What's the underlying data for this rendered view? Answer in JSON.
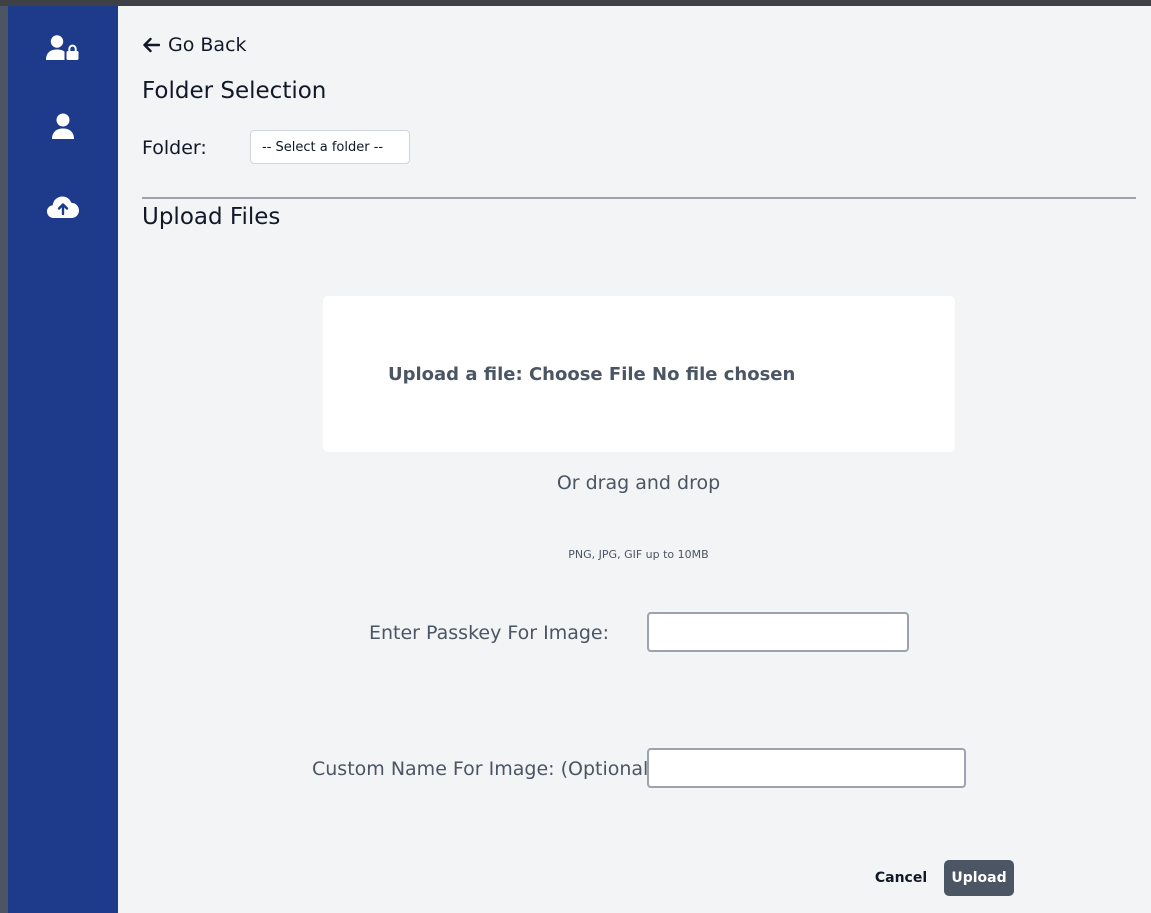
{
  "sidebar": {
    "items": [
      {
        "icon": "user-lock-icon"
      },
      {
        "icon": "user-icon"
      },
      {
        "icon": "cloud-upload-icon"
      }
    ]
  },
  "nav": {
    "back_label": "Go Back",
    "back_icon": "arrow-left-icon"
  },
  "folder_section": {
    "title": "Folder Selection",
    "folder_label": "Folder:",
    "folder_select_value": "-- Select a folder --"
  },
  "upload_section": {
    "title": "Upload Files",
    "upload_label": "Upload a file:",
    "choose_file_label": "Choose File",
    "file_status": "No file chosen",
    "drag_text": "Or drag and drop",
    "hint_text": "PNG, JPG, GIF up to 10MB",
    "passkey_label": "Enter Passkey For Image:",
    "passkey_value": "",
    "custom_name_label": "Custom Name For Image: (Optional)",
    "custom_name_value": ""
  },
  "actions": {
    "cancel_label": "Cancel",
    "upload_label": "Upload"
  },
  "colors": {
    "sidebar": "#1e3a8a",
    "background": "#f3f4f6",
    "button": "#4b5563"
  }
}
